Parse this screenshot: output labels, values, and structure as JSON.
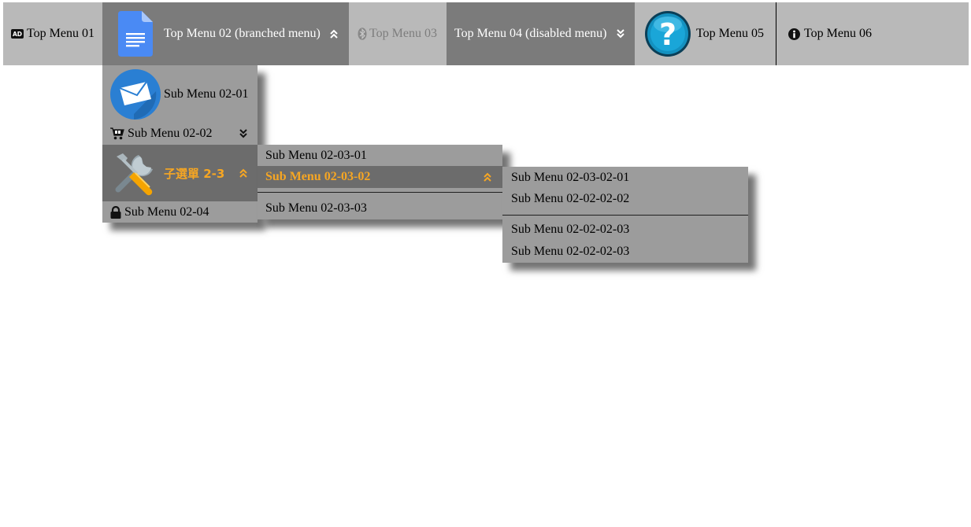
{
  "top_menu": {
    "item1": {
      "label": "Top Menu 01",
      "icon": "ad-icon"
    },
    "item2": {
      "label": "Top Menu 02 (branched menu)",
      "icon": "google-docs-icon"
    },
    "item3": {
      "label": "Top Menu 03",
      "icon": "bluetooth-icon"
    },
    "item4": {
      "label": "Top Menu 04 (disabled menu)"
    },
    "item5": {
      "label": "Top Menu 05",
      "icon": "help-icon"
    },
    "item6": {
      "label": "Top Menu 06",
      "icon": "info-icon"
    }
  },
  "submenu_02": {
    "item1": {
      "label": "Sub Menu 02-01",
      "icon": "mail-icon"
    },
    "item2": {
      "label": "Sub Menu 02-02",
      "icon": "cart-icon"
    },
    "item3": {
      "label": "子選單 2-3",
      "icon": "tools-icon"
    },
    "item4": {
      "label": "Sub Menu 02-04",
      "icon": "lock-icon"
    }
  },
  "submenu_02_03": {
    "item1": {
      "label": "Sub Menu 02-03-01"
    },
    "item2": {
      "label": "Sub Menu 02-03-02"
    },
    "item3": {
      "label": "Sub Menu 02-03-03"
    }
  },
  "submenu_02_03_02": {
    "item1": {
      "label": "Sub Menu 02-03-02-01"
    },
    "item2": {
      "label": "Sub Menu 02-02-02-02"
    },
    "item3": {
      "label": "Sub Menu 02-02-02-03"
    },
    "item4": {
      "label": "Sub Menu 02-02-02-03"
    }
  },
  "colors": {
    "bar": "#b9b9b9",
    "active": "#7b7b7b",
    "menu_bg": "#9c9c9c",
    "highlight": "#6c6c6c",
    "accent": "#f6a623"
  }
}
